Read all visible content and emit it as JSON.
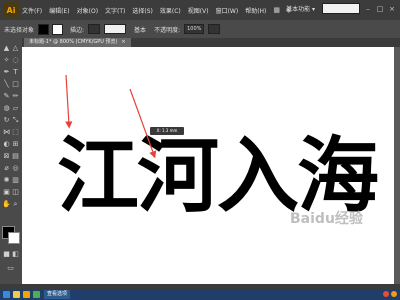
{
  "app": {
    "logo": "Ai"
  },
  "menubar": {
    "items": [
      "文件(F)",
      "编辑(E)",
      "对象(O)",
      "文字(T)",
      "选择(S)",
      "效果(C)",
      "视图(V)",
      "窗口(W)",
      "帮助(H)"
    ],
    "workspace": "基本功能 ▾",
    "search_placeholder": ""
  },
  "controlbar": {
    "label_none": "未选择对象",
    "stroke_label": "描边:",
    "stroke_value": "",
    "style_label": "基本",
    "opacity_label": "不透明度:",
    "opacity_value": "100%"
  },
  "document_tab": {
    "title": "未标题-1* @ 800% (CMYK/GPU 预览)",
    "close": "×"
  },
  "canvas": {
    "text": "江河入海",
    "tooltip": "X: 1.3 mm",
    "watermark": "Baidu经验"
  },
  "taskbar": {
    "app_label": "查看选项",
    "clock": ""
  },
  "colors": {
    "arrow": "#e8403a",
    "brand": "#f7a200",
    "taskbar": "#1f3f6a"
  },
  "icons": [
    "selection-tool-icon",
    "direct-selection-icon",
    "pen-tool-icon",
    "type-tool-icon",
    "line-tool-icon",
    "rectangle-tool-icon",
    "brush-tool-icon",
    "pencil-tool-icon",
    "rotate-tool-icon",
    "scale-tool-icon",
    "eyedropper-icon",
    "zoom-tool-icon"
  ]
}
